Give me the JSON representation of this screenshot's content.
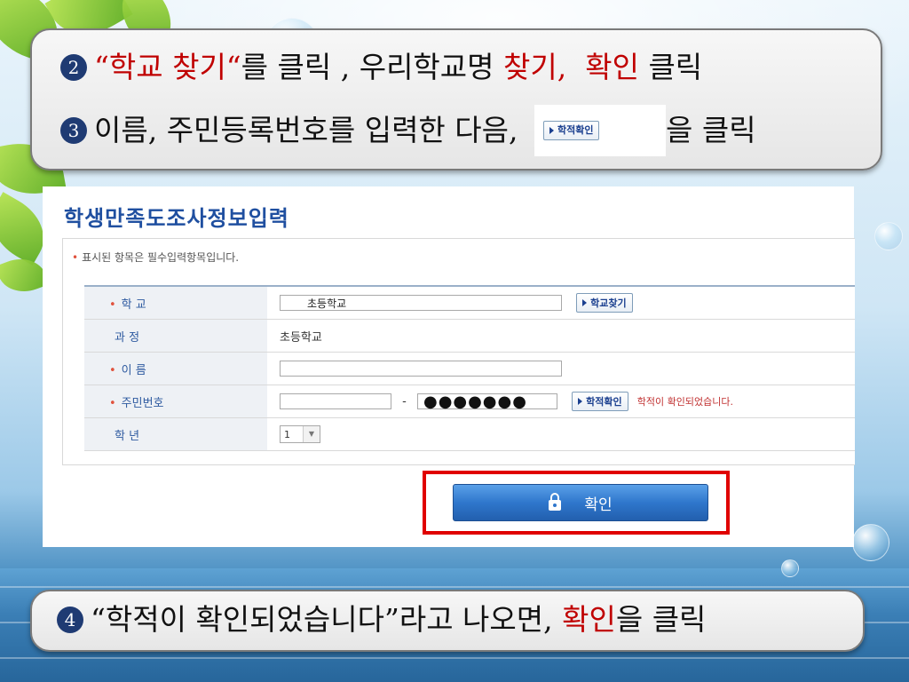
{
  "callout_top": {
    "line1": {
      "num": "2",
      "quote": "“학교 찾기“",
      "text1": "를 클릭 , 우리학교명 ",
      "find": "찾기,",
      "confirm": "확인",
      "text2": " 클릭"
    },
    "line2": {
      "num": "3",
      "text1": "이름, 주민등록번호를 입력한 다음, ",
      "button_label": "학적확인",
      "text2": "을 클릭"
    }
  },
  "form": {
    "title": "학생만족도조사정보입력",
    "note_marker": "•",
    "note": "표시된 항목은 필수입력항목입니다.",
    "rows": [
      {
        "required": "•",
        "label": "학 교",
        "value": "초등학교",
        "button": "학교찾기"
      },
      {
        "required": "",
        "label": "과 정",
        "value": "초등학교"
      },
      {
        "required": "•",
        "label": "이 름",
        "value": ""
      },
      {
        "required": "•",
        "label": "주민번호",
        "first": "",
        "dash": "-",
        "masked": "●●●●●●●",
        "button": "학적확인",
        "message": "학적이 확인되었습니다."
      },
      {
        "required": "",
        "label": "학 년",
        "select": "1"
      }
    ],
    "confirm_button": "확인"
  },
  "callout_bottom": {
    "num": "4",
    "text1": "“학적이 확인되었습니다”라고 나오면, ",
    "confirm": "확인",
    "text2": "을 클릭"
  },
  "colors": {
    "accent_red": "#c00000",
    "highlight": "#e00000",
    "button_blue": "#2f77cc",
    "title_blue": "#1f4fa0"
  }
}
